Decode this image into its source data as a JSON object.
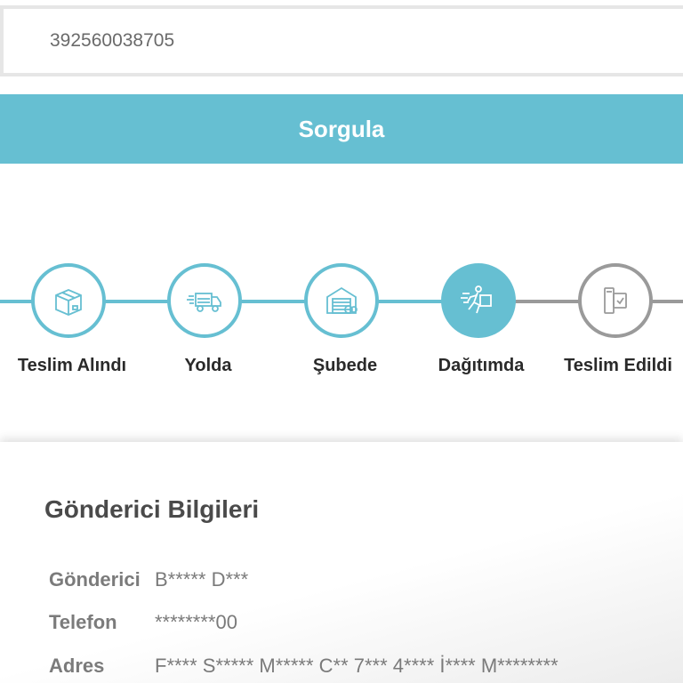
{
  "search": {
    "value": "392560038705"
  },
  "query_button": {
    "label": "Sorgula"
  },
  "steps": [
    {
      "label": "Teslim Alındı",
      "icon": "package-icon",
      "status": "done"
    },
    {
      "label": "Yolda",
      "icon": "delivery-truck-icon",
      "status": "done"
    },
    {
      "label": "Şubede",
      "icon": "warehouse-icon",
      "status": "done"
    },
    {
      "label": "Dağıtımda",
      "icon": "courier-running-icon",
      "status": "current"
    },
    {
      "label": "Teslim Edildi",
      "icon": "delivered-phone-icon",
      "status": "pending"
    }
  ],
  "sender": {
    "title": "Gönderici Bilgileri",
    "rows": [
      {
        "label": "Gönderici",
        "value": "B***** D***"
      },
      {
        "label": "Telefon",
        "value": "********00"
      },
      {
        "label": "Adres",
        "value": "F**** S***** M***** C** 7*** 4**** İ**** M********"
      }
    ]
  },
  "colors": {
    "accent": "#66bfd2",
    "pending": "#9a9a9a"
  }
}
